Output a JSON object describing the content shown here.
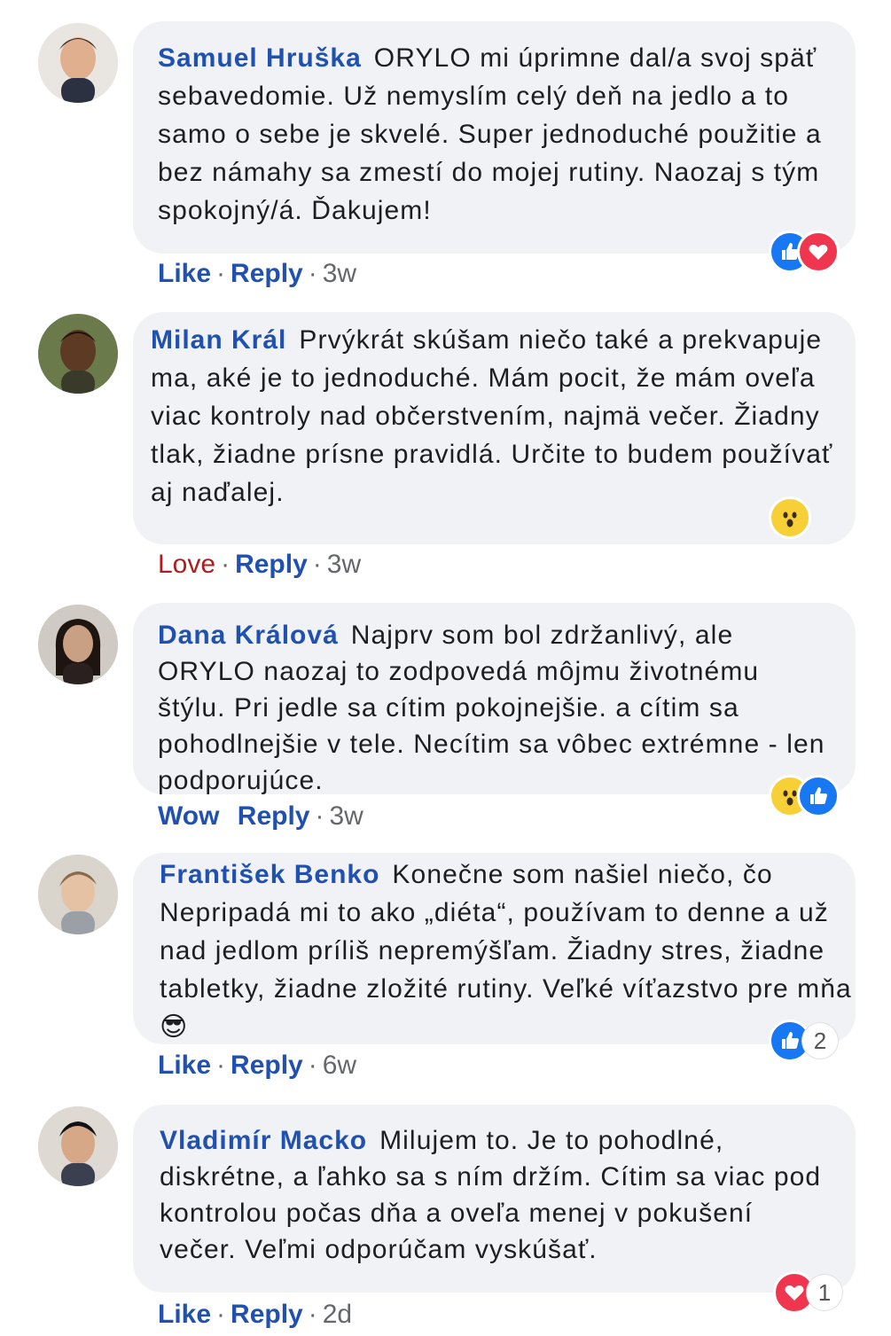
{
  "comments": [
    {
      "author": "Samuel Hruška",
      "text": "ORYLO mi úprimne dal/a svoj späť sebavedomie. Už nemyslím celý deň na jedlo a to samo o sebe je skvelé. Super jednoduché použitie a bez námahy sa zmestí do mojej rutiny. Naozaj s tým spokojný/á. Ďakujem!",
      "reaction_label": "Like",
      "reply_label": "Reply",
      "time": "3w",
      "reactions": [
        "like-icon",
        "love-icon"
      ]
    },
    {
      "author": "Milan Král",
      "text": "Prvýkrát skúšam niečo také a prekvapuje ma, aké je to jednoduché. Mám pocit, že mám oveľa viac kontroly nad občerstvením, najmä večer. Žiadny tlak, žiadne prísne pravidlá. Určite to budem používať aj naďalej.",
      "reaction_label": "Love",
      "reply_label": "Reply",
      "time": "3w",
      "reactions": [
        "wow-icon"
      ]
    },
    {
      "author": "Dana Králová",
      "text": "Najprv som bol zdržanlivý, ale ORYLO naozaj to zodpovedá môjmu životnému štýlu. Pri jedle sa cítim pokojnejšie. a cítim sa pohodlnejšie v tele. Necítim sa vôbec extrémne - len podporujúce.",
      "reaction_label": "Wow",
      "reply_label": "Reply",
      "time": "3w",
      "reactions": [
        "wow-icon",
        "like-icon"
      ]
    },
    {
      "author": "František Benko",
      "text": "Konečne som našiel niečo, čo Nepripadá mi to ako „diéta“, používam to denne a už nad jedlom príliš nepremýšľam. Žiadny stres, žiadne tabletky, žiadne zložité rutiny. Veľké víťazstvo pre mňa😎",
      "reaction_label": "Like",
      "reply_label": "Reply",
      "time": "6w",
      "reactions": [
        "like-icon"
      ],
      "reaction_count": "2"
    },
    {
      "author": "Vladimír Macko",
      "text": "Milujem to. Je to pohodlné, diskrétne, a ľahko sa s ním držím. Cítim sa viac pod kontrolou počas dňa a oveľa menej v pokušení večer. Veľmi odporúčam vyskúšať.",
      "reaction_label": "Like",
      "reply_label": "Reply",
      "time": "2d",
      "reactions": [
        "love-icon"
      ],
      "reaction_count": "1"
    }
  ],
  "colors": {
    "name": "#2050b0",
    "bubble": "#f0f2f5",
    "love_label": "#b01c1c",
    "like": "#1877f2",
    "love": "#f0364e",
    "wow": "#f7d038"
  }
}
